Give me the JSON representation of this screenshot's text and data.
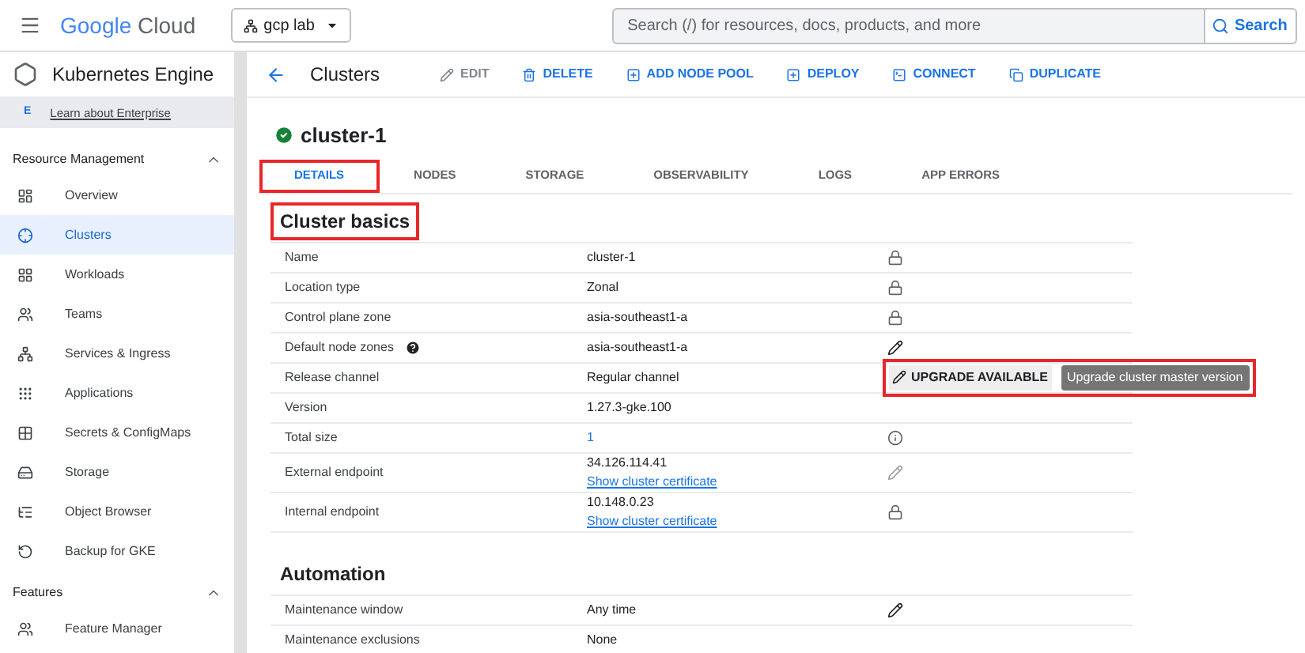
{
  "topbar": {
    "brand_first": "Google",
    "brand_second": "Cloud",
    "project": "gcp lab",
    "search": {
      "placeholder": "Search (/) for resources, docs, products, and more"
    },
    "search_button": "Search"
  },
  "product": {
    "title": "Kubernetes Engine",
    "promo_badge": "E",
    "promo_link": "Learn about Enterprise"
  },
  "sidebar": [
    {
      "title": "Resource Management",
      "expanded": true,
      "items": [
        {
          "label": "Overview",
          "selected": false
        },
        {
          "label": "Clusters",
          "selected": true
        },
        {
          "label": "Workloads",
          "selected": false
        },
        {
          "label": "Teams",
          "selected": false
        },
        {
          "label": "Services & Ingress",
          "selected": false
        },
        {
          "label": "Applications",
          "selected": false
        },
        {
          "label": "Secrets & ConfigMaps",
          "selected": false
        },
        {
          "label": "Storage",
          "selected": false
        },
        {
          "label": "Object Browser",
          "selected": false
        },
        {
          "label": "Backup for GKE",
          "selected": false
        }
      ]
    },
    {
      "title": "Features",
      "expanded": true,
      "items": [
        {
          "label": "Feature Manager",
          "selected": false
        }
      ]
    }
  ],
  "page_title": "Clusters",
  "actions": [
    {
      "label": "EDIT",
      "disabled": true
    },
    {
      "label": "DELETE",
      "disabled": false
    },
    {
      "label": "ADD NODE POOL",
      "disabled": false
    },
    {
      "label": "DEPLOY",
      "disabled": false
    },
    {
      "label": "CONNECT",
      "disabled": false
    },
    {
      "label": "DUPLICATE",
      "disabled": false
    }
  ],
  "cluster": {
    "name": "cluster-1"
  },
  "tabs": [
    {
      "label": "DETAILS",
      "selected": true,
      "highlighted": true
    },
    {
      "label": "NODES",
      "selected": false,
      "highlighted": false
    },
    {
      "label": "STORAGE",
      "selected": false,
      "highlighted": false
    },
    {
      "label": "OBSERVABILITY",
      "selected": false,
      "highlighted": false
    },
    {
      "label": "LOGS",
      "selected": false,
      "highlighted": false
    },
    {
      "label": "APP ERRORS",
      "selected": false,
      "highlighted": false
    }
  ],
  "sections": [
    {
      "title": "Cluster basics",
      "highlighted": true,
      "rows": [
        {
          "label": "Name",
          "value": "cluster-1",
          "action": {
            "kind": "lock"
          }
        },
        {
          "label": "Location type",
          "value": "Zonal",
          "action": {
            "kind": "lock"
          }
        },
        {
          "label": "Control plane zone",
          "value": "asia-southeast1-a",
          "action": {
            "kind": "lock"
          }
        },
        {
          "label": "Default node zones",
          "help": true,
          "value": "asia-southeast1-a",
          "action": {
            "kind": "edit"
          }
        },
        {
          "label": "Release channel",
          "value": "Regular channel",
          "action": {
            "kind": "upgrade",
            "button": "UPGRADE AVAILABLE",
            "tooltip": "Upgrade cluster master version",
            "highlighted": true
          }
        },
        {
          "label": "Version",
          "value": "1.27.3-gke.100"
        },
        {
          "label": "Total size",
          "value": "1",
          "value_link": true,
          "action": {
            "kind": "info"
          }
        },
        {
          "label": "External endpoint",
          "value": "34.126.114.41",
          "link": "Show cluster certificate",
          "action": {
            "kind": "edit-muted"
          }
        },
        {
          "label": "Internal endpoint",
          "value": "10.148.0.23",
          "link": "Show cluster certificate",
          "action": {
            "kind": "lock"
          }
        }
      ]
    },
    {
      "title": "Automation",
      "highlighted": false,
      "rows": [
        {
          "label": "Maintenance window",
          "value": "Any time",
          "action": {
            "kind": "edit"
          }
        },
        {
          "label": "Maintenance exclusions",
          "value": "None"
        }
      ]
    }
  ]
}
